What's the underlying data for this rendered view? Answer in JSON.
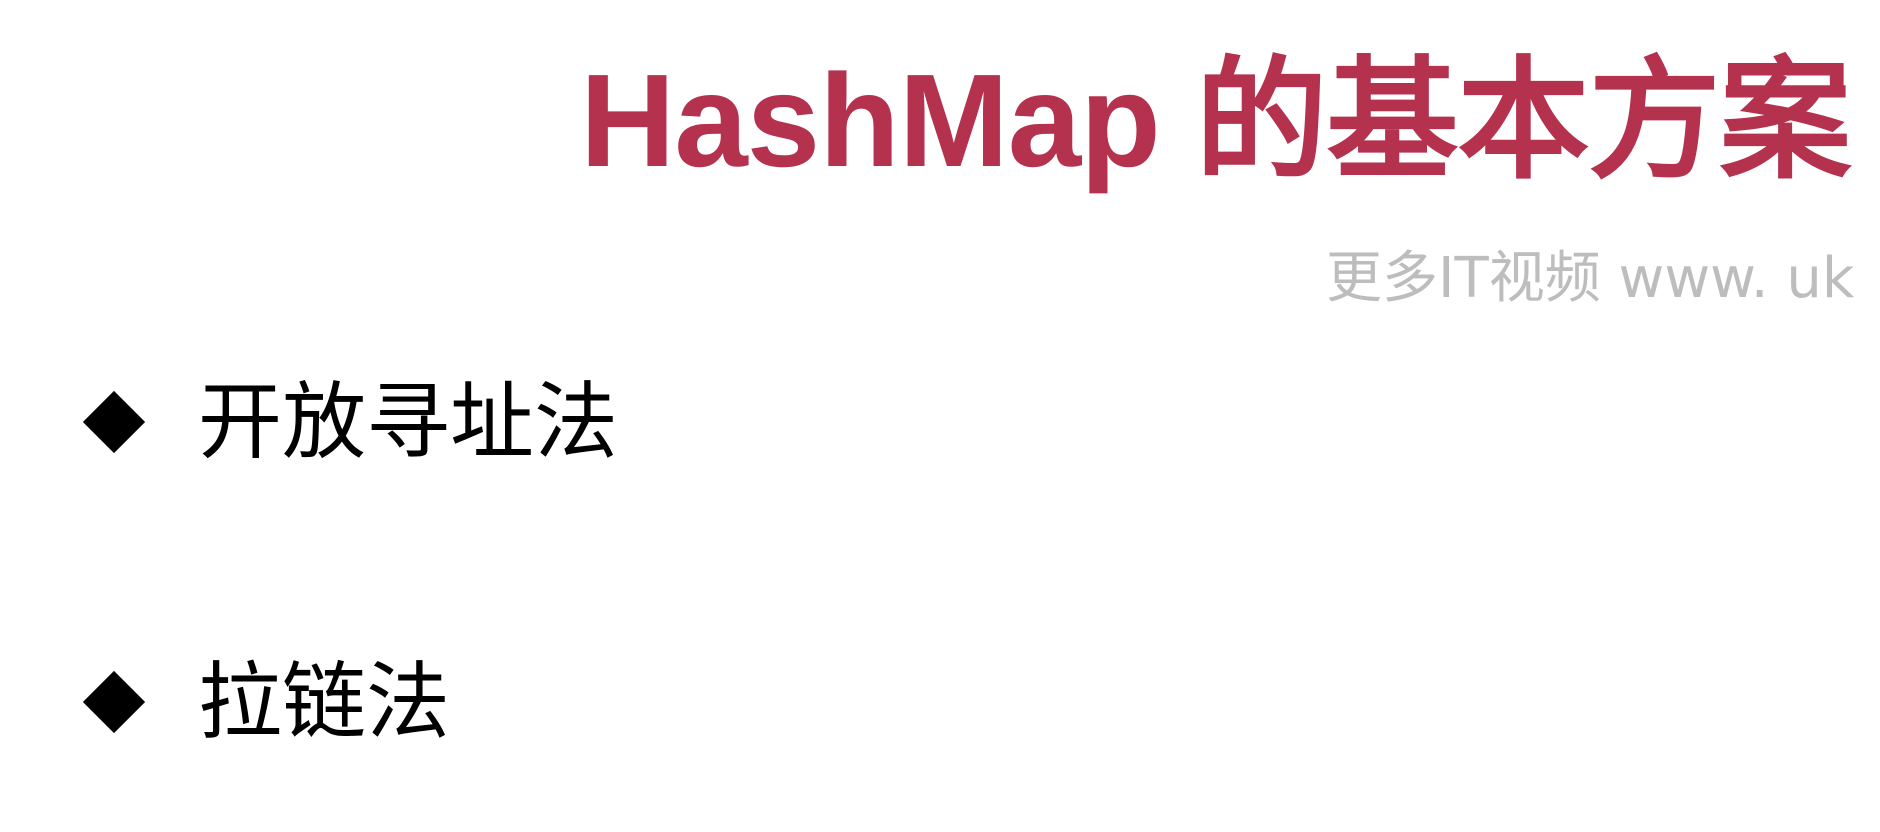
{
  "slide": {
    "title": "HashMap 的基本方案",
    "watermark": "更多IT视频 www. uk",
    "bullets": [
      {
        "icon": "diamond-bullet-icon",
        "text": "开放寻址法"
      },
      {
        "icon": "diamond-bullet-icon",
        "text": "拉链法"
      }
    ]
  },
  "colors": {
    "title": "#b5324f",
    "watermark": "#bdbdbd",
    "text": "#000000",
    "background": "#ffffff"
  }
}
